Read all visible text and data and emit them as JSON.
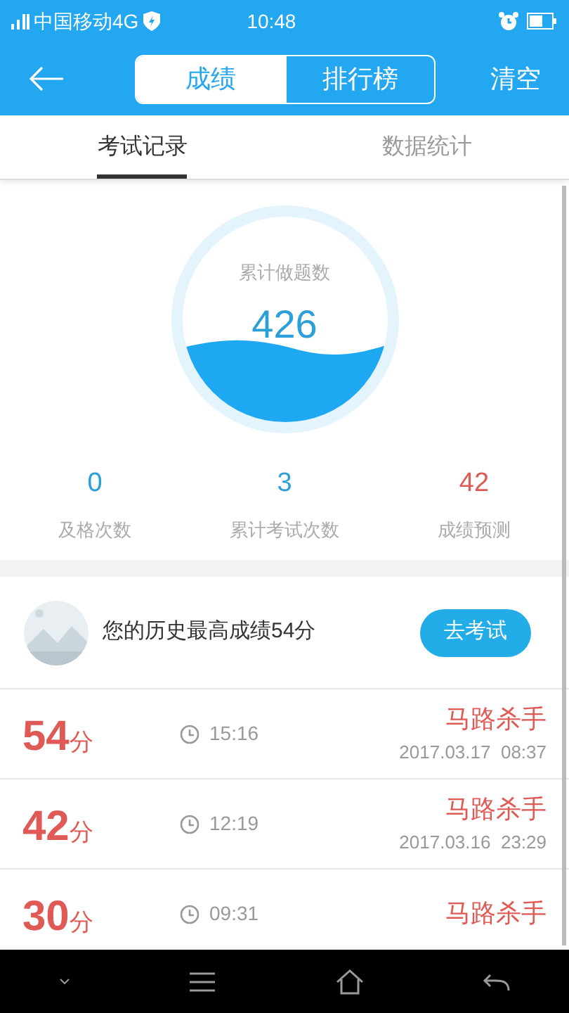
{
  "status_bar": {
    "carrier": "中国移动4G",
    "time": "10:48"
  },
  "header": {
    "segments": [
      {
        "label": "成绩",
        "selected": true
      },
      {
        "label": "排行榜",
        "selected": false
      }
    ],
    "action": "清空"
  },
  "tabs": [
    {
      "label": "考试记录",
      "selected": true
    },
    {
      "label": "数据统计",
      "selected": false
    }
  ],
  "summary": {
    "label": "累计做题数",
    "value": "426",
    "stats": [
      {
        "value": "0",
        "label": "及格次数",
        "color": "#2a9fd8"
      },
      {
        "value": "3",
        "label": "累计考试次数",
        "color": "#2a9fd8"
      },
      {
        "value": "42",
        "label": "成绩预测",
        "color": "#e05a55"
      }
    ]
  },
  "best": {
    "text": "您的历史最高成绩54分",
    "button": "去考试"
  },
  "records": [
    {
      "score": "54",
      "unit": "分",
      "duration": "15:16",
      "title": "马路杀手",
      "date": "2017.03.17  08:37"
    },
    {
      "score": "42",
      "unit": "分",
      "duration": "12:19",
      "title": "马路杀手",
      "date": "2017.03.16  23:29"
    },
    {
      "score": "30",
      "unit": "分",
      "duration": "09:31",
      "title": "马路杀手"
    }
  ]
}
